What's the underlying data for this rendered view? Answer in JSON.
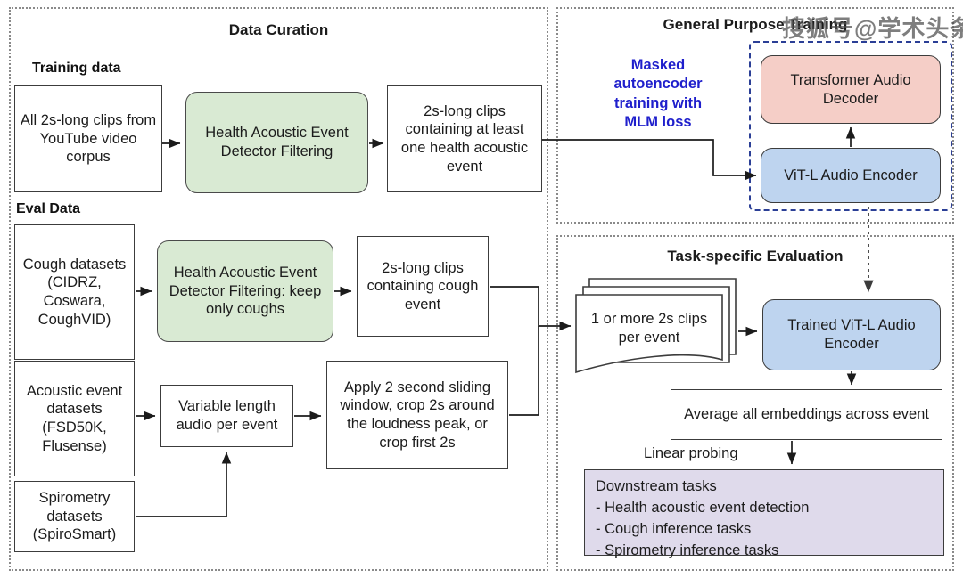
{
  "figure": {
    "watermark": "搜狐号@学术头条"
  },
  "panels": {
    "data_curation": {
      "title": "Data Curation",
      "training_label": "Training data",
      "eval_label": "Eval Data",
      "boxes": {
        "youtube_clips": "All 2s-long clips from YouTube video corpus",
        "haed_filter": "Health Acoustic Event Detector Filtering",
        "clips_health_event": "2s-long clips containing at least one health acoustic event",
        "cough_datasets": "Cough datasets (CIDRZ, Coswara, CoughVID)",
        "haed_filter_coughs": "Health Acoustic Event Detector Filtering: keep only coughs",
        "clips_cough_event": "2s-long clips containing cough event",
        "acoustic_event_datasets": "Acoustic event datasets (FSD50K, Flusense)",
        "spirometry_datasets": "Spirometry datasets (SpiroSmart)",
        "variable_length_audio": "Variable length audio per event",
        "sliding_window": "Apply 2 second sliding window, crop 2s around the loudness peak, or crop first 2s"
      }
    },
    "general_purpose_training": {
      "title": "General Purpose Training",
      "annotation": "Masked autoencoder training with MLM loss",
      "boxes": {
        "transformer_decoder": "Transformer Audio Decoder",
        "vitl_encoder": "ViT-L Audio Encoder"
      }
    },
    "task_specific_evaluation": {
      "title": "Task-specific Evaluation",
      "probing_label": "Linear probing",
      "boxes": {
        "clips_per_event": "1 or more 2s clips per event",
        "trained_encoder": "Trained ViT-L Audio Encoder",
        "average_embeddings": "Average all embeddings across event"
      },
      "downstream": {
        "heading": "Downstream tasks",
        "items": [
          "- Health acoustic event detection",
          "- Cough inference tasks",
          "- Spirometry inference tasks"
        ]
      }
    }
  },
  "colors": {
    "green_box": "#d9ead3",
    "pink_box": "#f5cec7",
    "blue_box": "#bed4ef",
    "purple_box": "#dfdaeb",
    "annotation_text": "#1f1fcc",
    "dashed_border": "#2b3f96"
  }
}
